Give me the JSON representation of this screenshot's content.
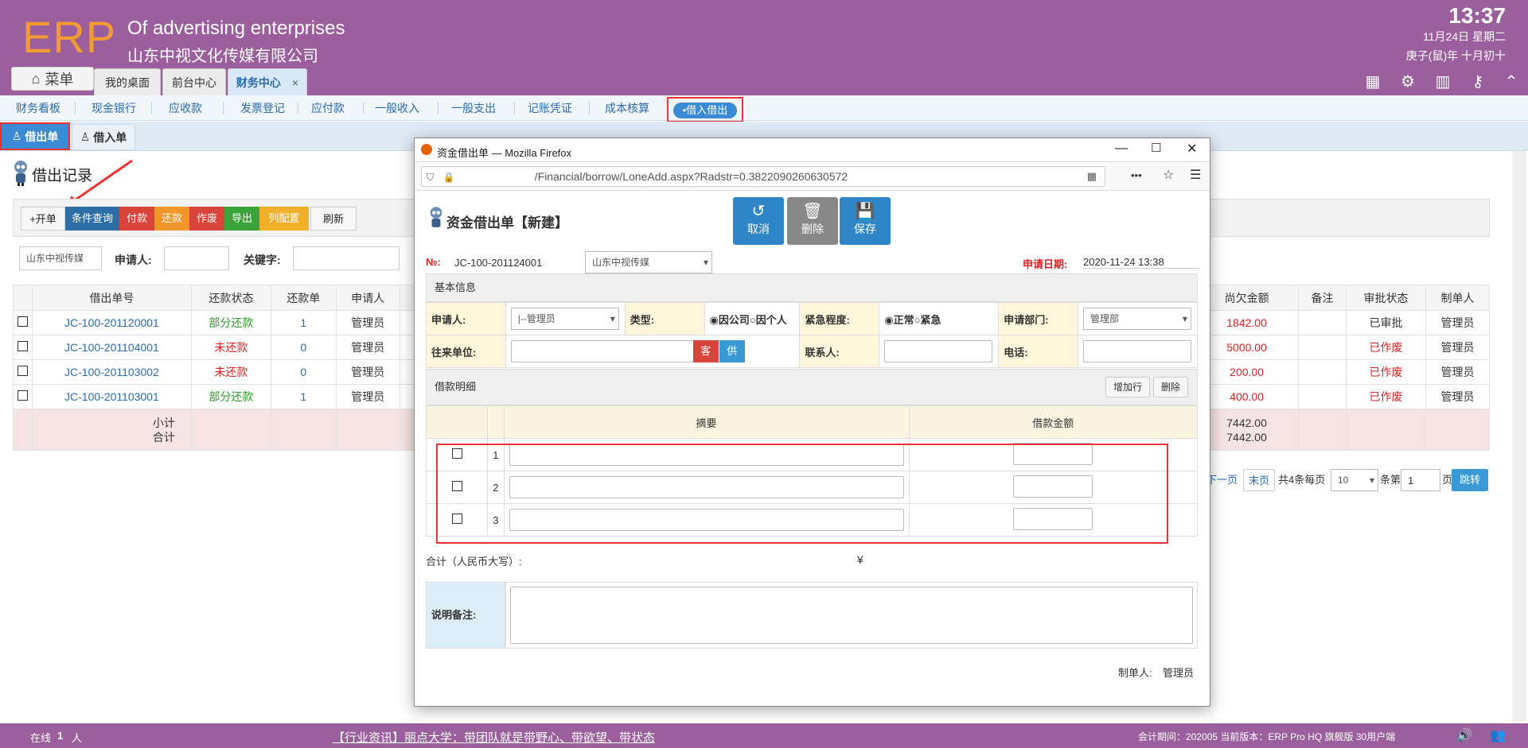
{
  "header": {
    "logo": "ERP",
    "company_en": "Of advertising enterprises",
    "company_cn": "山东中视文化传媒有限公司",
    "time": "13:37",
    "date": "11月24日 星期二",
    "lunar": "庚子(鼠)年 十月初十",
    "menu_label": "菜单",
    "tabs": [
      {
        "label": "我的桌面"
      },
      {
        "label": "前台中心"
      },
      {
        "label": "财务中心",
        "close": "×"
      }
    ]
  },
  "nav": {
    "items": [
      "财务看板",
      "现金银行",
      "应收款",
      "发票登记",
      "应付款",
      "一般收入",
      "一般支出",
      "记账凭证",
      "成本核算"
    ],
    "active": "•借入借出"
  },
  "subtabs": {
    "lend": "借出单",
    "borrow": "借入单"
  },
  "page": {
    "title": "借出记录",
    "toolbar": [
      "+开单",
      "条件查询",
      "付款",
      "还款",
      "作废",
      "导出",
      "列配置",
      "刷新"
    ],
    "filter": {
      "company": "山东中视传媒",
      "applicant_label": "申请人:",
      "keyword_label": "关键字:"
    },
    "table": {
      "headers": [
        "借出单号",
        "还款状态",
        "还款单",
        "申请人"
      ],
      "right_headers": [
        "尚欠金额",
        "备注",
        "审批状态",
        "制单人"
      ],
      "rows": [
        {
          "no": "JC-100-201120001",
          "status": "部分还款",
          "count": "1",
          "applicant": "管理员",
          "owed": "1842.00",
          "approval": "已审批",
          "maker": "管理员"
        },
        {
          "no": "JC-100-201104001",
          "status": "未还款",
          "count": "0",
          "applicant": "管理员",
          "owed": "5000.00",
          "approval": "已作废",
          "maker": "管理员"
        },
        {
          "no": "JC-100-201103002",
          "status": "未还款",
          "count": "0",
          "applicant": "管理员",
          "owed": "200.00",
          "approval": "已作废",
          "maker": "管理员"
        },
        {
          "no": "JC-100-201103001",
          "status": "部分还款",
          "count": "1",
          "applicant": "管理员",
          "owed": "400.00",
          "approval": "已作废",
          "maker": "管理员"
        }
      ],
      "subtotal_label": "小计",
      "total_label": "合计",
      "subtotal": "7442.00",
      "total": "7442.00"
    },
    "pagination": {
      "next": "下一页",
      "last": "末页",
      "summary": "共4条每页",
      "per_page": "10",
      "unit1": "条第",
      "page": "1",
      "unit2": "页",
      "go": "跳转"
    }
  },
  "footer": {
    "online_label": "在线",
    "online_count": "1",
    "online_unit": "人",
    "news": "【行业资讯】丽点大学：带团队就是带野心、带欲望、带状态",
    "info": "会计期间：202005 当前版本：ERP Pro HQ 旗舰版 30用户端"
  },
  "popup": {
    "window_title": "资金借出单 — Mozilla Firefox",
    "url": "/Financial/borrow/LoneAdd.aspx?Radstr=0.3822090260630572",
    "form_title": "资金借出单【新建】",
    "buttons": {
      "cancel": "取消",
      "delete": "删除",
      "save": "保存"
    },
    "no_label": "№:",
    "no_value": "JC-100-201124001",
    "company": "山东中视传媒",
    "date_label": "申请日期:",
    "date_value": "2020-11-24 13:38",
    "basic_section": "基本信息",
    "fields": {
      "applicant_label": "申请人:",
      "applicant_value": "|--管理员",
      "type_label": "类型:",
      "type_company": "因公司",
      "type_personal": "因个人",
      "urgency_label": "紧急程度:",
      "urgency_normal": "正常",
      "urgency_urgent": "紧急",
      "dept_label": "申请部门:",
      "dept_value": "管理部",
      "partner_label": "往来单位:",
      "partner_btn1": "客",
      "partner_btn2": "供",
      "contact_label": "联系人:",
      "phone_label": "电话:"
    },
    "detail_section": "借款明细",
    "add_row": "增加行",
    "del_row": "删除",
    "detail_headers": {
      "summary": "摘要",
      "amount": "借款金额"
    },
    "detail_rows": [
      "1",
      "2",
      "3"
    ],
    "total_label": "合计（人民币大写）:",
    "total_symbol": "¥",
    "remark_label": "说明备注:",
    "maker_label": "制单人:",
    "maker_value": "管理员"
  }
}
